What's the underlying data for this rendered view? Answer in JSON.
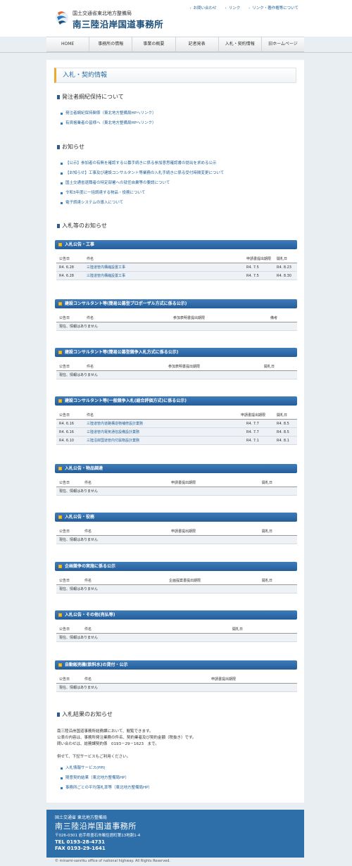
{
  "header": {
    "org": "国土交通省東北地方整備局",
    "title": "南三陸沿岸国道事務所",
    "util_links": [
      "お問い合わせ",
      "リンク",
      "リンク・著作権等について"
    ]
  },
  "nav": [
    "HOME",
    "事務所の情報",
    "事業の概要",
    "記者発表",
    "入札・契約情報",
    "旧ホームページ"
  ],
  "page_heading": "入札・契約情報",
  "compliance": {
    "heading": "発注者綱紀保持について",
    "links": [
      "発注者綱紀保持関係（東北地方整備局HPへリンク）",
      "有資格業者の皆様へ（東北地方整備局HPへリンク）"
    ]
  },
  "notices": {
    "heading": "お知らせ",
    "links": [
      "【公示】参加者の有無を確認する公募手続きに係る参加意思確認書の提出を求める公示",
      "【お知らせ】工事及び建設コンサルタント等業務の入札手続きに係る受付時間変更について",
      "国土交通省退職者の特定部署への就任自粛等の要請について",
      "令和3年度に一括調達する物品・役務について",
      "電子調達システムの導入について"
    ]
  },
  "bid_notices_heading": "入札等のお知らせ",
  "empty_text": "現在、情報はありません",
  "sections": [
    {
      "title": "入札公告・工事",
      "headers": [
        "公告日",
        "件名",
        "申請書提出期限",
        "開札日"
      ],
      "rows": [
        [
          "R4. 6.28",
          "三陸道管内構縮設置工事",
          "R4. 7.5",
          "R4. 8.23"
        ],
        [
          "R4. 6.28",
          "三陸道管内構縮設置工事",
          "R4. 7.5",
          "R4. 8.30"
        ]
      ]
    },
    {
      "title": "建設コンサルタント等(簡易公募型プロポーザル方式に係る公示)",
      "headers": [
        "公告日",
        "件名",
        "参加表明書提出期限",
        "備考"
      ],
      "rows": []
    },
    {
      "title": "建設コンサルタント等(簡易公募型競争入札方式に係る公示)",
      "headers": [
        "公告日",
        "件名",
        "参加表明書提出期限",
        "開札日"
      ],
      "rows": []
    },
    {
      "title": "建設コンサルタント等(一般競争入札(総合評価方式)に係る公示)",
      "headers": [
        "公告日",
        "件名",
        "申請書提出期限",
        "開札日"
      ],
      "rows": [
        [
          "R4. 6.16",
          "三陸道管内道路構造物補修設計業務",
          "R4. 7.7",
          "R4. 8.5"
        ],
        [
          "R4. 6.16",
          "三陸道管内電気通信設備設計業務",
          "R4. 7.7",
          "R4. 8.5"
        ],
        [
          "R4. 6.10",
          "三陸沿岸国道管内付属物設計業務",
          "R4. 7.1",
          "R4. 8.1"
        ]
      ]
    },
    {
      "title": "入札公告・物品調達",
      "headers": [
        "公告日",
        "件名",
        "申請書提出期限",
        "開札日"
      ],
      "rows": []
    },
    {
      "title": "入札公告・役務",
      "headers": [
        "公告日",
        "件名",
        "申請書提出期限",
        "開札日"
      ],
      "rows": []
    },
    {
      "title": "企画競争の実施に係る公示",
      "headers": [
        "公告日",
        "件名",
        "企画提案書提出期限",
        "開札日"
      ],
      "rows": []
    },
    {
      "title": "入札公告・その他(売払等)",
      "headers": [
        "公告日",
        "件名",
        "開札日"
      ],
      "rows": []
    },
    {
      "title": "自動販売機(飲料水)の貸付・公示",
      "headers": [
        "公告日",
        "件名",
        "申請書提出期限"
      ],
      "rows": []
    }
  ],
  "results": {
    "heading": "入札結果のお知らせ",
    "paragraph": [
      "南三陸沿岸国道事務所総務課において、閲覧できます。",
      "公表の内容は、事務所発注業務の件名、契約業者及び契約金額（税抜き）です。",
      "問い合わせは、総務課契約係　0193－29－1623　まで。"
    ],
    "services_intro": "併せて、下記サービスもご利用ください。",
    "links": [
      "入札情報サービス(PPI)",
      "随意契約結果（東北地方整備局HP）",
      "事務所ごとの平均落札率等（東北地方整備局HP）"
    ]
  },
  "footer": {
    "org": "国土交通省 東北地方整備局",
    "title": "南三陸沿岸国道事務所",
    "address": "〒026-0301 岩手県釜石市鵜住居町第13地割1-4",
    "tel": "TEL 0193-28-4731",
    "fax": "FAX 0193-29-1641"
  },
  "copyright": "© minami-sanriku office of national highway. All Rights Reserved.",
  "colors": {
    "accent": "#2a5c8f",
    "bar": "#245d99",
    "link": "#1f5f98",
    "footer": "#2f6fa9"
  }
}
